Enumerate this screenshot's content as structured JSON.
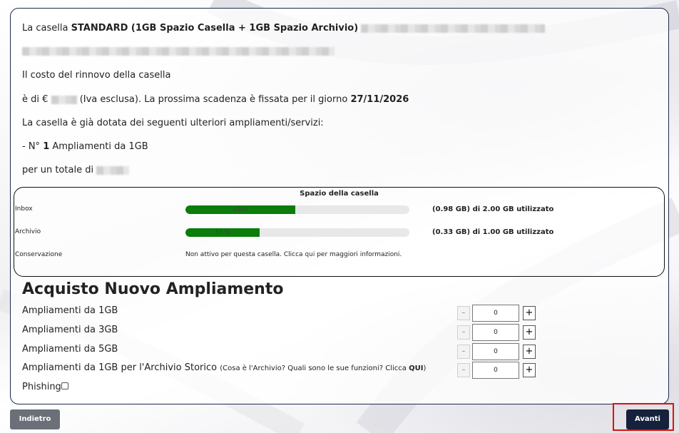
{
  "intro": {
    "line1_prefix": "La casella ",
    "line1_bold": "STANDARD (1GB Spazio Casella + 1GB Spazio Archivio)",
    "renew_text": "Il costo del rinnovo della casella",
    "price_prefix": "è di €",
    "price_suffix": "(Iva esclusa). La prossima scadenza è fissata per il giorno ",
    "expiry_date": "27/11/2026",
    "extras_text": "La casella è già dotata dei seguenti ulteriori ampliamenti/servizi:",
    "extra_prefix": "- N° ",
    "extra_count": "1",
    "extra_suffix": " Ampliamenti da 1GB",
    "total_text": "per un totale di"
  },
  "space": {
    "title": "Spazio della casella",
    "inbox": {
      "label": "Inbox",
      "percent_text": "49%",
      "fraction": 0.49,
      "usage": "(0.98 GB) di 2.00 GB utilizzato"
    },
    "archive": {
      "label": "Archivio",
      "percent_text": "33 %",
      "fraction": 0.33,
      "usage": "(0.33 GB) di 1.00 GB utilizzato"
    },
    "conservation": {
      "label": "Conservazione",
      "text_prefix": "Non attivo per questa casella. Clicca ",
      "link": "qui",
      "text_suffix": " per maggiori informazioni."
    }
  },
  "purchase": {
    "title": "Acquisto Nuovo Ampliamento",
    "rows": [
      {
        "label": "Ampliamenti da 1GB",
        "qty": "0"
      },
      {
        "label": "Ampliamenti da 3GB",
        "qty": "0"
      },
      {
        "label": "Ampliamenti da 5GB",
        "qty": "0"
      },
      {
        "label": "Ampliamenti da 1GB per l'Archivio Storico",
        "note_prefix": "(Cosa è l'Archivio? Quali sono le sue funzioni? Clicca ",
        "note_link": "QUI",
        "note_suffix": ")",
        "qty": "0"
      }
    ],
    "minus": "-",
    "plus": "+",
    "phishing_label": "Phishing"
  },
  "buttons": {
    "back": "Indietro",
    "next": "Avanti"
  }
}
